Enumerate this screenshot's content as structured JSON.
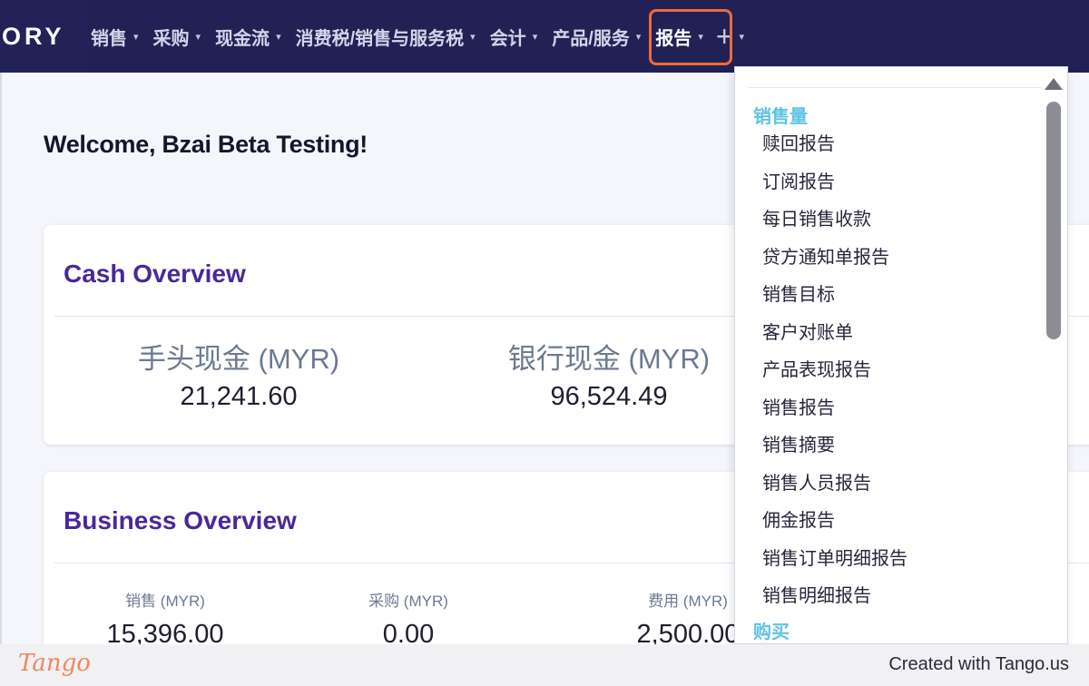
{
  "brand": {
    "text": "ORY"
  },
  "nav": {
    "items": [
      {
        "label": "销售"
      },
      {
        "label": "采购"
      },
      {
        "label": "现金流"
      },
      {
        "label": "消费税/销售与服务税"
      },
      {
        "label": "会计"
      },
      {
        "label": "产品/服务"
      },
      {
        "label": "报告"
      }
    ],
    "plus": "+",
    "caret": "▾"
  },
  "welcome": "Welcome, Bzai Beta Testing!",
  "cash_overview": {
    "title": "Cash Overview",
    "cash_on_hand": {
      "label": "手头现金 (MYR)",
      "value": "21,241.60"
    },
    "cash_in_bank": {
      "label": "银行现金 (MYR)",
      "value": "96,524.49"
    }
  },
  "business_overview": {
    "title": "Business Overview",
    "sales": {
      "label": "销售 (MYR)",
      "value": "15,396.00"
    },
    "purchases": {
      "label": "采购 (MYR)",
      "value": "0.00"
    },
    "expenses": {
      "label": "费用 (MYR)",
      "value": "2,500.00"
    }
  },
  "report_menu": {
    "section_sales": "销售量",
    "items": [
      "赎回报告",
      "订阅报告",
      "每日销售收款",
      "贷方通知单报告",
      "销售目标",
      "客户对账单",
      "产品表现报告",
      "销售报告",
      "销售摘要",
      "销售人员报告",
      "佣金报告",
      "销售订单明细报告",
      "销售明细报告"
    ],
    "section_purchases": "购买"
  },
  "footer": {
    "logo": "Tango",
    "credit": "Created with Tango.us"
  },
  "colors": {
    "nav_bg": "#222155",
    "title_purple": "#4a2898",
    "section_cyan": "#5ec3e4",
    "highlight_orange": "#ee6a3a"
  }
}
